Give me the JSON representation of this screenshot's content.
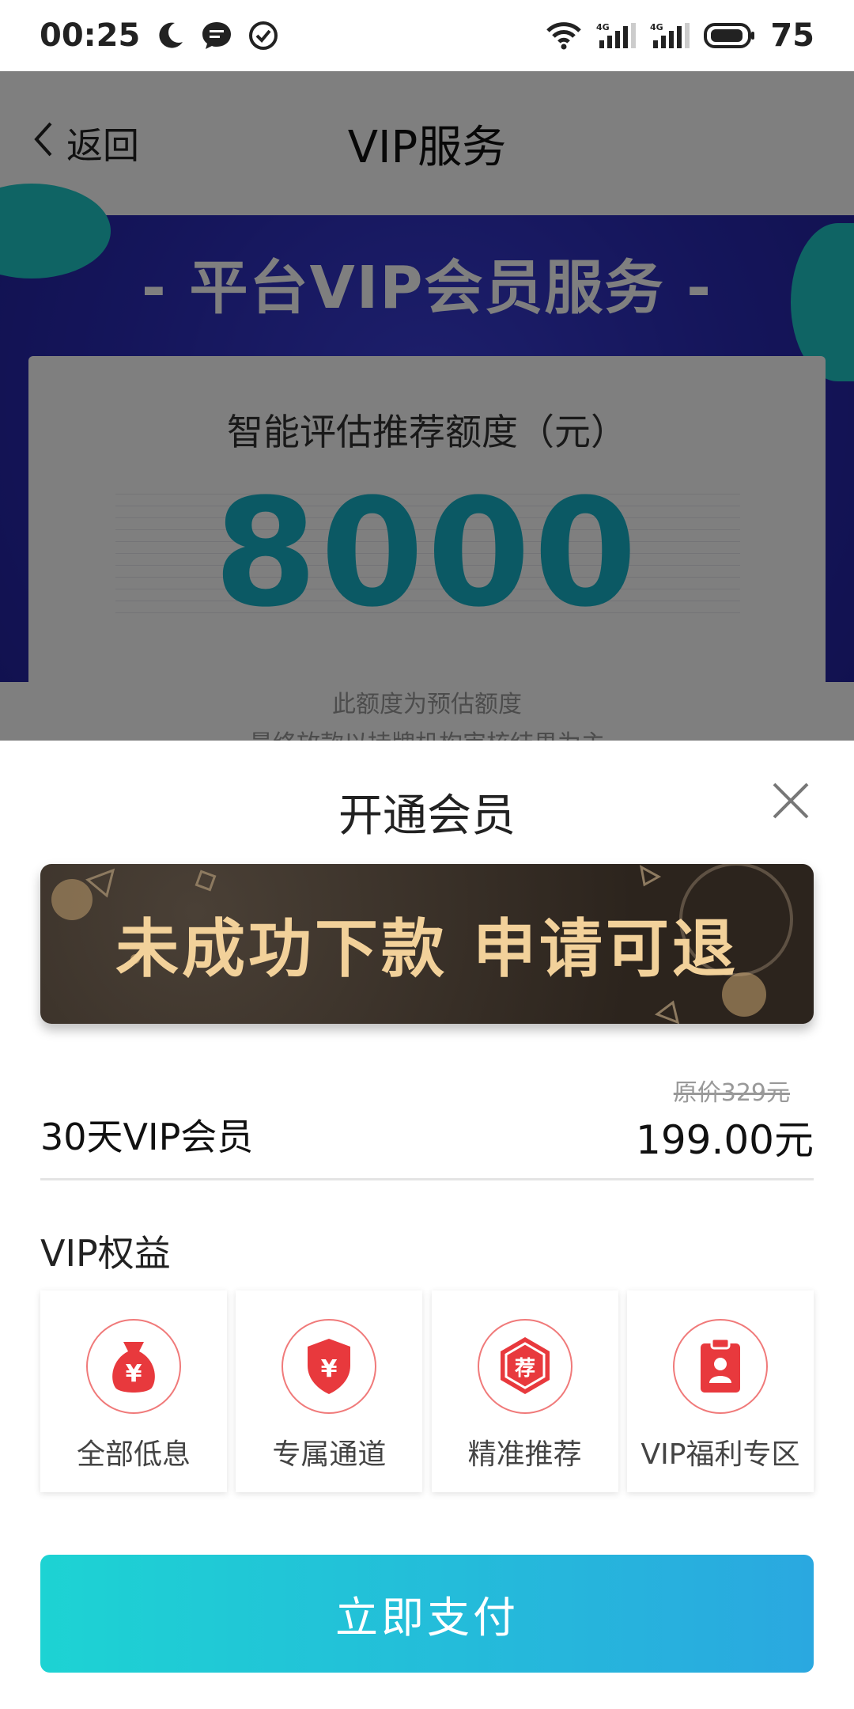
{
  "status_bar": {
    "time": "00:25",
    "battery": "75",
    "network_label_1": "4G",
    "network_label_2": "4G"
  },
  "background": {
    "back_label": "返回",
    "nav_title": "VIP服务",
    "hero_title": "- 平台VIP会员服务 -",
    "quota_label": "智能评估推荐额度（元）",
    "quota_value": "8000",
    "quota_note_1": "此额度为预估额度",
    "quota_note_2": "最终放款以持牌机构审核结果为主"
  },
  "sheet": {
    "title": "开通会员",
    "promo_text": "未成功下款 申请可退",
    "plan_name": "30天VIP会员",
    "original_price": "原价329元",
    "price": "199.00元",
    "benefits_title": "VIP权益",
    "benefits": [
      {
        "label": "全部低息",
        "icon": "money-bag-icon",
        "glyph": "¥"
      },
      {
        "label": "专属通道",
        "icon": "shield-icon",
        "glyph": "¥"
      },
      {
        "label": "精准推荐",
        "icon": "recommend-icon",
        "glyph": "荐"
      },
      {
        "label": "VIP福利专区",
        "icon": "clipboard-user-icon",
        "glyph": ""
      }
    ],
    "pay_label": "立即支付"
  },
  "colors": {
    "accent_teal": "#1dd3d3",
    "accent_blue": "#2aa8e0",
    "quota_value": "#16b3c9",
    "benefit_icon_red": "#e8393d",
    "promo_gold": "#f2d19a"
  }
}
